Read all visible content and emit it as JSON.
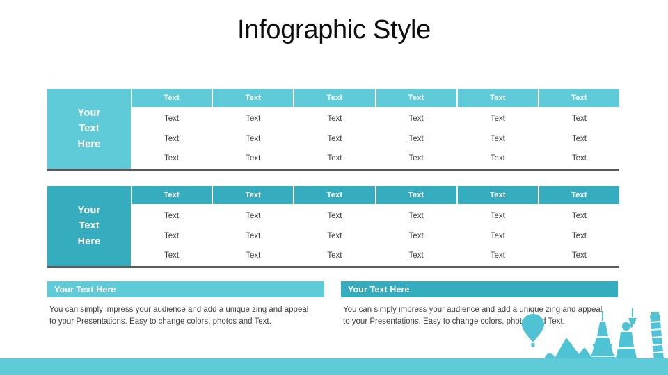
{
  "title": "Infographic Style",
  "colors": {
    "teal_light": "#5fcbd8",
    "teal_dark": "#35adbe",
    "rule": "#58595b",
    "body_text": "#3f3f3f",
    "title_text": "#0d0d0d"
  },
  "tables": [
    {
      "side_label": "Your\nText\nHere",
      "theme": "light",
      "headers": [
        "Text",
        "Text",
        "Text",
        "Text",
        "Text",
        "Text"
      ],
      "rows": [
        [
          "Text",
          "Text",
          "Text",
          "Text",
          "Text",
          "Text"
        ],
        [
          "Text",
          "Text",
          "Text",
          "Text",
          "Text",
          "Text"
        ],
        [
          "Text",
          "Text",
          "Text",
          "Text",
          "Text",
          "Text"
        ]
      ]
    },
    {
      "side_label": "Your\nText\nHere",
      "theme": "dark",
      "headers": [
        "Text",
        "Text",
        "Text",
        "Text",
        "Text",
        "Text"
      ],
      "rows": [
        [
          "Text",
          "Text",
          "Text",
          "Text",
          "Text",
          "Text"
        ],
        [
          "Text",
          "Text",
          "Text",
          "Text",
          "Text",
          "Text"
        ],
        [
          "Text",
          "Text",
          "Text",
          "Text",
          "Text",
          "Text"
        ]
      ]
    }
  ],
  "notes": [
    {
      "heading": "Your Text Here",
      "body": "You can simply impress your audience and add a unique zing and appeal to your Presentations. Easy to change colors, photos and Text."
    },
    {
      "heading": "Your Text Here",
      "body": "You can simply impress your audience and add a unique zing and appeal to your Presentations. Easy to change colors, photos and Text."
    }
  ],
  "decoration": {
    "icons": [
      "hot-air-balloon-icon",
      "mountains-icon",
      "eiffel-tower-icon",
      "statue-of-liberty-icon",
      "leaning-tower-of-pisa-icon"
    ]
  }
}
